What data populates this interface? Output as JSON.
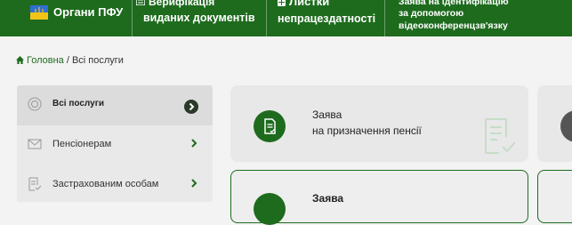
{
  "nav": {
    "pfu_label": "Органи ПФУ",
    "verif_line1": "Верифікація",
    "verif_line2": "виданих документів",
    "sick_line1": "Листки",
    "sick_line2": "непрацездатності",
    "video_line1": "Заява на ідентифікацію",
    "video_line2": "за допомогою",
    "video_line3": "відеоконференцзв'язку"
  },
  "breadcrumb": {
    "home": "Головна",
    "separator": " / ",
    "current": "Всі послуги"
  },
  "sidebar": {
    "items": [
      {
        "label": "Всі послуги",
        "icon": "circle-icon",
        "active": true
      },
      {
        "label": "Пенсіонерам",
        "icon": "envelope-icon",
        "active": false
      },
      {
        "label": "Застрахованим особам",
        "icon": "document-check-icon",
        "active": false
      }
    ]
  },
  "cards": [
    {
      "title_line1": "Заява",
      "title_line2": "на призначення пенсії"
    },
    {
      "title_line1": "Заява"
    }
  ],
  "colors": {
    "brand_green": "#1e6b1e",
    "dark_chevron": "#2a3a2a"
  }
}
